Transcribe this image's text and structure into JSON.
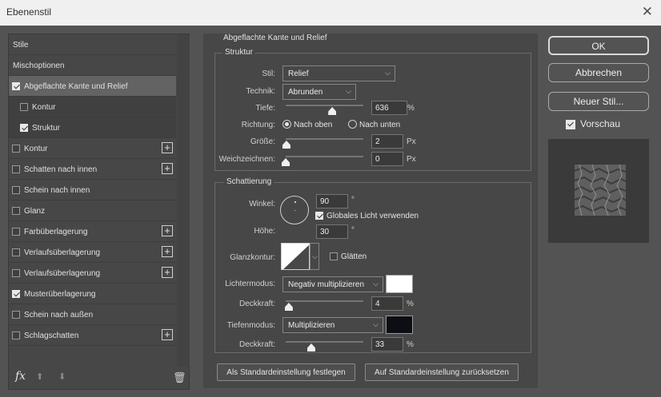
{
  "window": {
    "title": "Ebenenstil",
    "close_glyph": "✕"
  },
  "styles_list": {
    "items": [
      {
        "label": "Stile",
        "checkbox": null,
        "plus": false,
        "state": "normal"
      },
      {
        "label": "Mischoptionen",
        "checkbox": null,
        "plus": false,
        "state": "normal"
      },
      {
        "label": "Abgeflachte Kante und Relief",
        "checkbox": true,
        "plus": false,
        "state": "selected"
      },
      {
        "label": "Kontur",
        "checkbox": false,
        "plus": false,
        "state": "sub"
      },
      {
        "label": "Struktur",
        "checkbox": true,
        "plus": false,
        "state": "sub"
      },
      {
        "label": "Kontur",
        "checkbox": false,
        "plus": true,
        "state": "normal"
      },
      {
        "label": "Schatten nach innen",
        "checkbox": false,
        "plus": true,
        "state": "normal"
      },
      {
        "label": "Schein nach innen",
        "checkbox": false,
        "plus": false,
        "state": "normal"
      },
      {
        "label": "Glanz",
        "checkbox": false,
        "plus": false,
        "state": "normal"
      },
      {
        "label": "Farbüberlagerung",
        "checkbox": false,
        "plus": true,
        "state": "normal"
      },
      {
        "label": "Verlaufsüberlagerung",
        "checkbox": false,
        "plus": true,
        "state": "normal"
      },
      {
        "label": "Verlaufsüberlagerung",
        "checkbox": false,
        "plus": true,
        "state": "normal"
      },
      {
        "label": "Musterüberlagerung",
        "checkbox": true,
        "plus": false,
        "state": "normal"
      },
      {
        "label": "Schein nach außen",
        "checkbox": false,
        "plus": false,
        "state": "normal"
      },
      {
        "label": "Schlagschatten",
        "checkbox": false,
        "plus": true,
        "state": "normal"
      }
    ],
    "fx_label": "fx",
    "plus_glyph": "+",
    "up_glyph": "⬆",
    "down_glyph": "⬇",
    "trash_glyph": "🗑"
  },
  "main": {
    "section_title": "Abgeflachte Kante und Relief",
    "struktur": {
      "title": "Struktur",
      "stil_label": "Stil:",
      "stil_value": "Relief",
      "technik_label": "Technik:",
      "technik_value": "Abrunden",
      "tiefe_label": "Tiefe:",
      "tiefe_value": "636",
      "tiefe_unit": "%",
      "tiefe_slider": 0.6,
      "richtung_label": "Richtung:",
      "richtung_up": "Nach oben",
      "richtung_down": "Nach unten",
      "groesse_label": "Größe:",
      "groesse_value": "2",
      "groesse_unit": "Px",
      "groesse_slider": 0.01,
      "weich_label": "Weichzeichnen:",
      "weich_value": "0",
      "weich_unit": "Px",
      "weich_slider": 0.0
    },
    "schattierung": {
      "title": "Schattierung",
      "winkel_label": "Winkel:",
      "winkel_value": "90",
      "winkel_unit": "°",
      "global_label": "Globales Licht verwenden",
      "hoehe_label": "Höhe:",
      "hoehe_value": "30",
      "hoehe_unit": "°",
      "glanz_label": "Glanzkontur:",
      "glaetten_label": "Glätten",
      "licht_label": "Lichtermodus:",
      "licht_value": "Negativ multiplizieren",
      "licht_color": "#ffffff",
      "deck1_label": "Deckkraft:",
      "deck1_value": "4",
      "deck1_unit": "%",
      "deck1_slider": 0.04,
      "tiefen_label": "Tiefenmodus:",
      "tiefen_value": "Multiplizieren",
      "tiefen_color": "#0b0f14",
      "deck2_label": "Deckkraft:",
      "deck2_value": "33",
      "deck2_unit": "%",
      "deck2_slider": 0.33
    },
    "btn_default": "Als Standardeinstellung festlegen",
    "btn_reset": "Auf Standardeinstellung zurücksetzen"
  },
  "side": {
    "ok": "OK",
    "cancel": "Abbrechen",
    "new_style": "Neuer Stil...",
    "preview_label": "Vorschau",
    "preview_checked": true
  },
  "icons": {
    "chevron": "⌵"
  }
}
